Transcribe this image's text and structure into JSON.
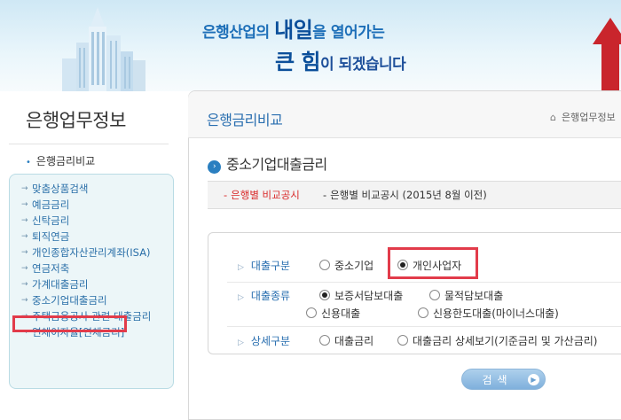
{
  "banner": {
    "slogan_line1_a": "은행산업의 ",
    "slogan_line1_big": "내일",
    "slogan_line1_b": "을 열어가는",
    "slogan_line2_big": "큰 힘",
    "slogan_line2_b": "이 되겠습니다"
  },
  "sidebar": {
    "title": "은행업무정보",
    "category": "은행금리비교",
    "items": [
      {
        "label": "맞춤상품검색"
      },
      {
        "label": "예금금리"
      },
      {
        "label": "신탁금리"
      },
      {
        "label": "퇴직연금"
      },
      {
        "label": "개인종합자산관리계좌(ISA)"
      },
      {
        "label": "연금저축"
      },
      {
        "label": "가계대출금리"
      },
      {
        "label": "중소기업대출금리"
      },
      {
        "label": "주택금융공사 관련 대출금리"
      },
      {
        "label": "연체이자율[연체금리]"
      }
    ]
  },
  "main": {
    "title": "은행금리비교",
    "breadcrumb": "은행업무정보",
    "section_title": "중소기업대출금리",
    "tabs": [
      {
        "label": "은행별 비교공시",
        "active": true
      },
      {
        "label": "은행별 비교공시 (2015년 8월 이전)",
        "active": false
      }
    ],
    "form": {
      "loan_type_label": "대출구분",
      "loan_type_options": [
        "중소기업",
        "개인사업자"
      ],
      "loan_type_selected": "개인사업자",
      "loan_kind_label": "대출종류",
      "loan_kind_options": [
        "보증서담보대출",
        "물적담보대출",
        "신용대출",
        "신용한도대출(마이너스대출)"
      ],
      "loan_kind_selected": "보증서담보대출",
      "detail_label": "상세구분",
      "detail_options": [
        "대출금리",
        "대출금리 상세보기(기준금리 및 가산금리)"
      ],
      "search_label": "검색"
    }
  },
  "colors": {
    "accent_blue": "#2a6fb0",
    "highlight_red": "#e23b4a",
    "active_tab_red": "#d92b2b"
  }
}
